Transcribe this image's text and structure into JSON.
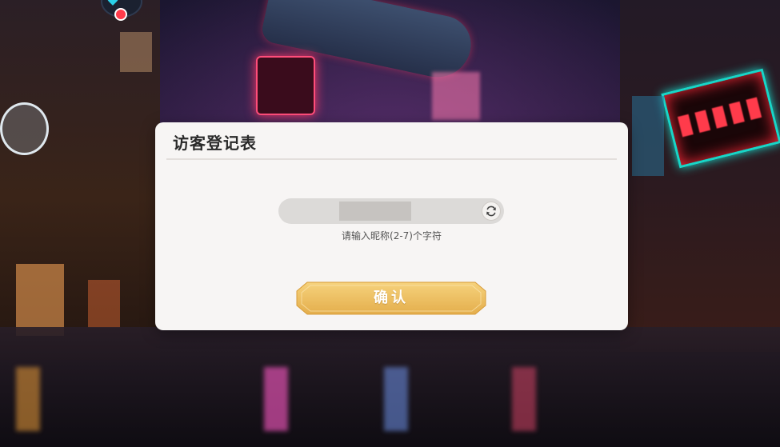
{
  "dialog": {
    "title": "访客登记表",
    "name_input_value": "",
    "hint": "请输入昵称(2-7)个字符",
    "confirm_label": "确认"
  },
  "icons": {
    "refresh": "refresh-icon",
    "badge": "map-marker-icon"
  },
  "colors": {
    "dialog_bg": "#f7f5f4",
    "button_gold": "#ecbd5c",
    "input_bg": "#dcdad8"
  }
}
